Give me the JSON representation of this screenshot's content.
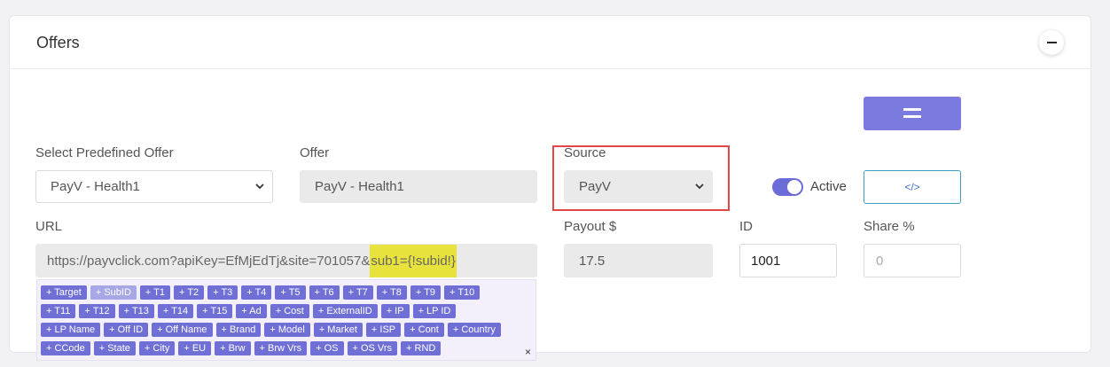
{
  "card": {
    "title": "Offers"
  },
  "fields": {
    "predefined": {
      "label": "Select Predefined Offer",
      "value": "PayV - Health1"
    },
    "offer": {
      "label": "Offer",
      "value": "PayV - Health1"
    },
    "source": {
      "label": "Source",
      "value": "PayV"
    },
    "active": {
      "label": "Active",
      "checked": true
    },
    "url": {
      "label": "URL",
      "value_prefix": "https://payvclick.com?apiKey=EfMjEdTj&site=701057&",
      "value_highlight": "sub1={!subid!}"
    },
    "payout": {
      "label": "Payout $",
      "value": "17.5"
    },
    "id": {
      "label": "ID",
      "value": "1001"
    },
    "share": {
      "label": "Share %",
      "placeholder": "0"
    }
  },
  "buttons": {
    "code_icon": "</>"
  },
  "tag_rows": [
    [
      "+ Target",
      "+ SubID",
      "+ T1",
      "+ T2",
      "+ T3",
      "+ T4",
      "+ T5",
      "+ T6",
      "+ T7",
      "+ T8",
      "+ T9",
      "+ T10"
    ],
    [
      "+ T11",
      "+ T12",
      "+ T13",
      "+ T14",
      "+ T15",
      "+ Ad",
      "+ Cost",
      "+ ExternalID",
      "+ IP",
      "+ LP ID"
    ],
    [
      "+ LP Name",
      "+ Off ID",
      "+ Off Name",
      "+ Brand",
      "+ Model",
      "+ Market",
      "+ ISP",
      "+ Cont",
      "+ Country"
    ],
    [
      "+ CCode",
      "+ State",
      "+ City",
      "+ EU",
      "+ Brw",
      "+ Brw Vrs",
      "+ OS",
      "+ OS Vrs",
      "+ RND"
    ]
  ],
  "muted_tags": [
    "+ SubID"
  ],
  "tag_panel": {
    "close": "×"
  },
  "colors": {
    "accent": "#7b7bdf",
    "tag": "#6f6fd6",
    "highlight": "#e8e23c",
    "frame": "#e04848"
  }
}
